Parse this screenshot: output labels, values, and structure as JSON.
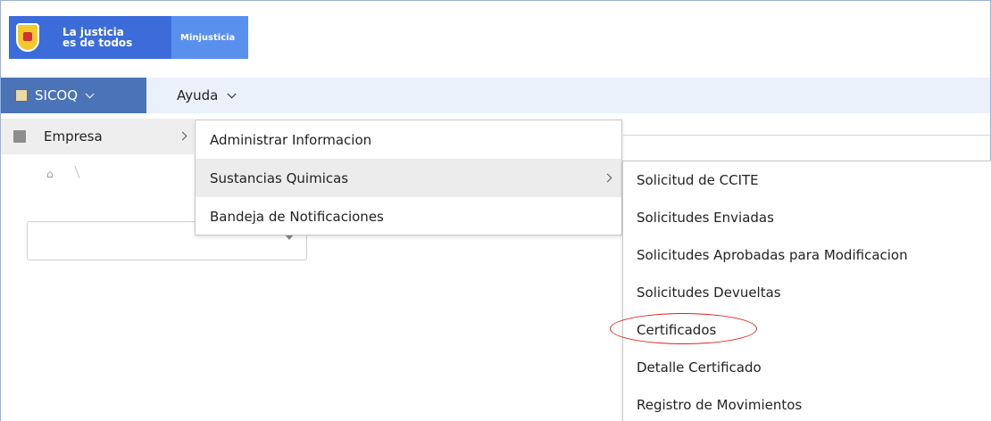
{
  "header": {
    "brand_line1": "La justicia",
    "brand_line2": "es de todos",
    "ministry": "Minjusticia"
  },
  "menubar": {
    "app_menu": "SICOQ",
    "help_menu": "Ayuda"
  },
  "level1": {
    "item": "Empresa"
  },
  "level2": {
    "items": [
      {
        "label": "Administrar Informacion"
      },
      {
        "label": "Sustancias Quimicas"
      },
      {
        "label": "Bandeja de Notificaciones"
      }
    ]
  },
  "level3": {
    "items": [
      {
        "label": "Solicitud de CCITE"
      },
      {
        "label": "Solicitudes Enviadas"
      },
      {
        "label": "Solicitudes Aprobadas para Modificacion"
      },
      {
        "label": "Solicitudes Devueltas"
      },
      {
        "label": "Certificados"
      },
      {
        "label": "Detalle Certificado"
      },
      {
        "label": "Registro de Movimientos"
      }
    ]
  },
  "colors": {
    "brand_blue": "#3b6cd9",
    "menu_active": "#4b73b7",
    "highlight": "#dd2222"
  },
  "icons": [
    "coat-of-arms-icon",
    "calendar-icon",
    "building-icon",
    "home-icon",
    "chevron-down-icon",
    "chevron-right-icon"
  ]
}
